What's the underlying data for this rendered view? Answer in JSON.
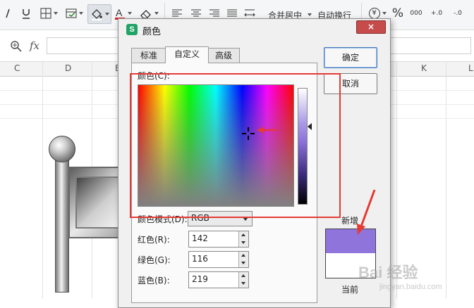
{
  "ribbon": {
    "merge_center_label": "合并居中",
    "auto_wrap_label": "自动换行",
    "currency_icon": "¥",
    "percent_icon": "%",
    "thousands_icon": "000",
    "inc_decimal_icon": "+.0",
    "dec_decimal_icon": "-.0"
  },
  "formula_bar": {
    "fx_label": "fx",
    "value": ""
  },
  "grid": {
    "columns": [
      "C",
      "D",
      "E",
      "K",
      "L"
    ]
  },
  "dialog": {
    "title": "颜色",
    "close_label": "×",
    "app_icon": "S",
    "tabs": [
      {
        "label": "标准",
        "active": false
      },
      {
        "label": "自定义",
        "active": true
      },
      {
        "label": "高级",
        "active": false
      }
    ],
    "color_label": "颜色(C):",
    "color_mode_label": "颜色模式(D):",
    "color_mode_value": "RGB",
    "red_label": "红色(R):",
    "red_value": "142",
    "green_label": "绿色(G):",
    "green_value": "116",
    "blue_label": "蓝色(B):",
    "blue_value": "219",
    "ok_label": "确定",
    "cancel_label": "取消",
    "new_label": "新增",
    "current_label": "当前",
    "new_color": "#8e74db",
    "current_color": "#ffffff"
  },
  "watermark": {
    "text": "Bai 经验",
    "sub": "jingyan.baidu.com"
  },
  "colors": {
    "annotation_red": "#e53a35",
    "accent_green": "#21a366"
  }
}
